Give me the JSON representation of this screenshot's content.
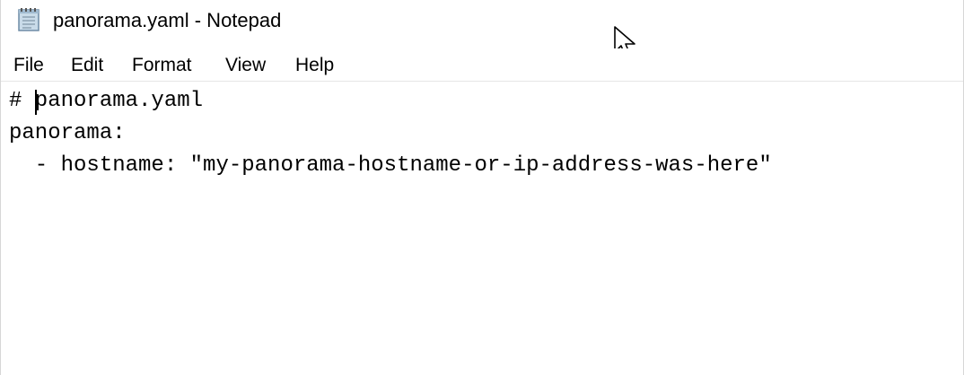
{
  "window": {
    "title": "panorama.yaml - Notepad",
    "app_icon": "notepad-icon"
  },
  "menu": {
    "items": [
      "File",
      "Edit",
      "Format",
      "View",
      "Help"
    ]
  },
  "editor": {
    "lines": [
      "# panorama.yaml",
      "panorama:",
      "  - hostname: \"my-panorama-hostname-or-ip-address-was-here\""
    ]
  },
  "pointer": "mouse-pointer-icon"
}
